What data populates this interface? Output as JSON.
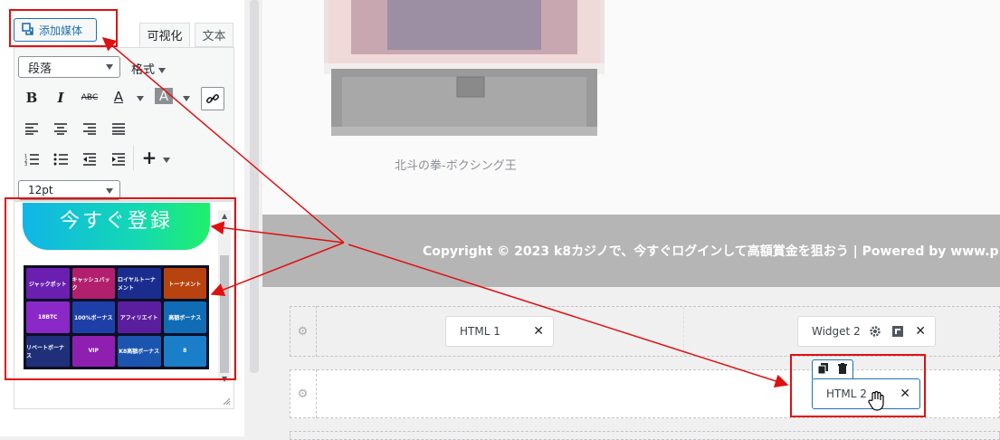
{
  "editor": {
    "add_media_label": "添加媒体",
    "tabs": {
      "visual": "可视化",
      "text": "文本"
    },
    "format_select": "段落",
    "format_menu": "格式",
    "font_size_select": "12pt",
    "toolbar_icons": [
      "bold-icon",
      "italic-icon",
      "strikethrough-icon",
      "text-color-icon",
      "background-color-icon",
      "link-icon",
      "align-left-icon",
      "align-center-icon",
      "align-right-icon",
      "justify-icon",
      "ordered-list-icon",
      "unordered-list-icon",
      "outdent-icon",
      "indent-icon",
      "insert-plus-icon"
    ],
    "banner_text": "今すぐ登録",
    "promo_tiles": [
      {
        "text": "ジャックポット",
        "color": "#6a1fb0"
      },
      {
        "text": "キャッシュバック",
        "color": "#b11f6d"
      },
      {
        "text": "ロイヤルトーナメント",
        "color": "#1a2d8f"
      },
      {
        "text": "トーナメント",
        "color": "#b8430f"
      },
      {
        "text": "18BTC",
        "color": "#8a28c8"
      },
      {
        "text": "100%ボーナス",
        "color": "#1f3fa8"
      },
      {
        "text": "アフィリエイト",
        "color": "#5b1e9e"
      },
      {
        "text": "高額ボーナス",
        "color": "#0f6cb5"
      },
      {
        "text": "リベートボーナス",
        "color": "#1f2f7a"
      },
      {
        "text": "VIP",
        "color": "#8f1fb0"
      },
      {
        "text": "K8高額ボーナス",
        "color": "#1b55b0"
      },
      {
        "text": "8",
        "color": "#1a7ec8"
      }
    ]
  },
  "preview": {
    "caption": "北斗の拳-ボクシング王",
    "copyright": "Copyright © 2023 k8カジノで、今すぐログインして高額賞金を狙おう | Powered by www.p"
  },
  "builder": {
    "widget_html1": "HTML 1",
    "widget_2": "Widget 2",
    "widget_html2": "HTML 2"
  },
  "colors": {
    "highlight": "#e01010",
    "accent": "#2271b1"
  }
}
